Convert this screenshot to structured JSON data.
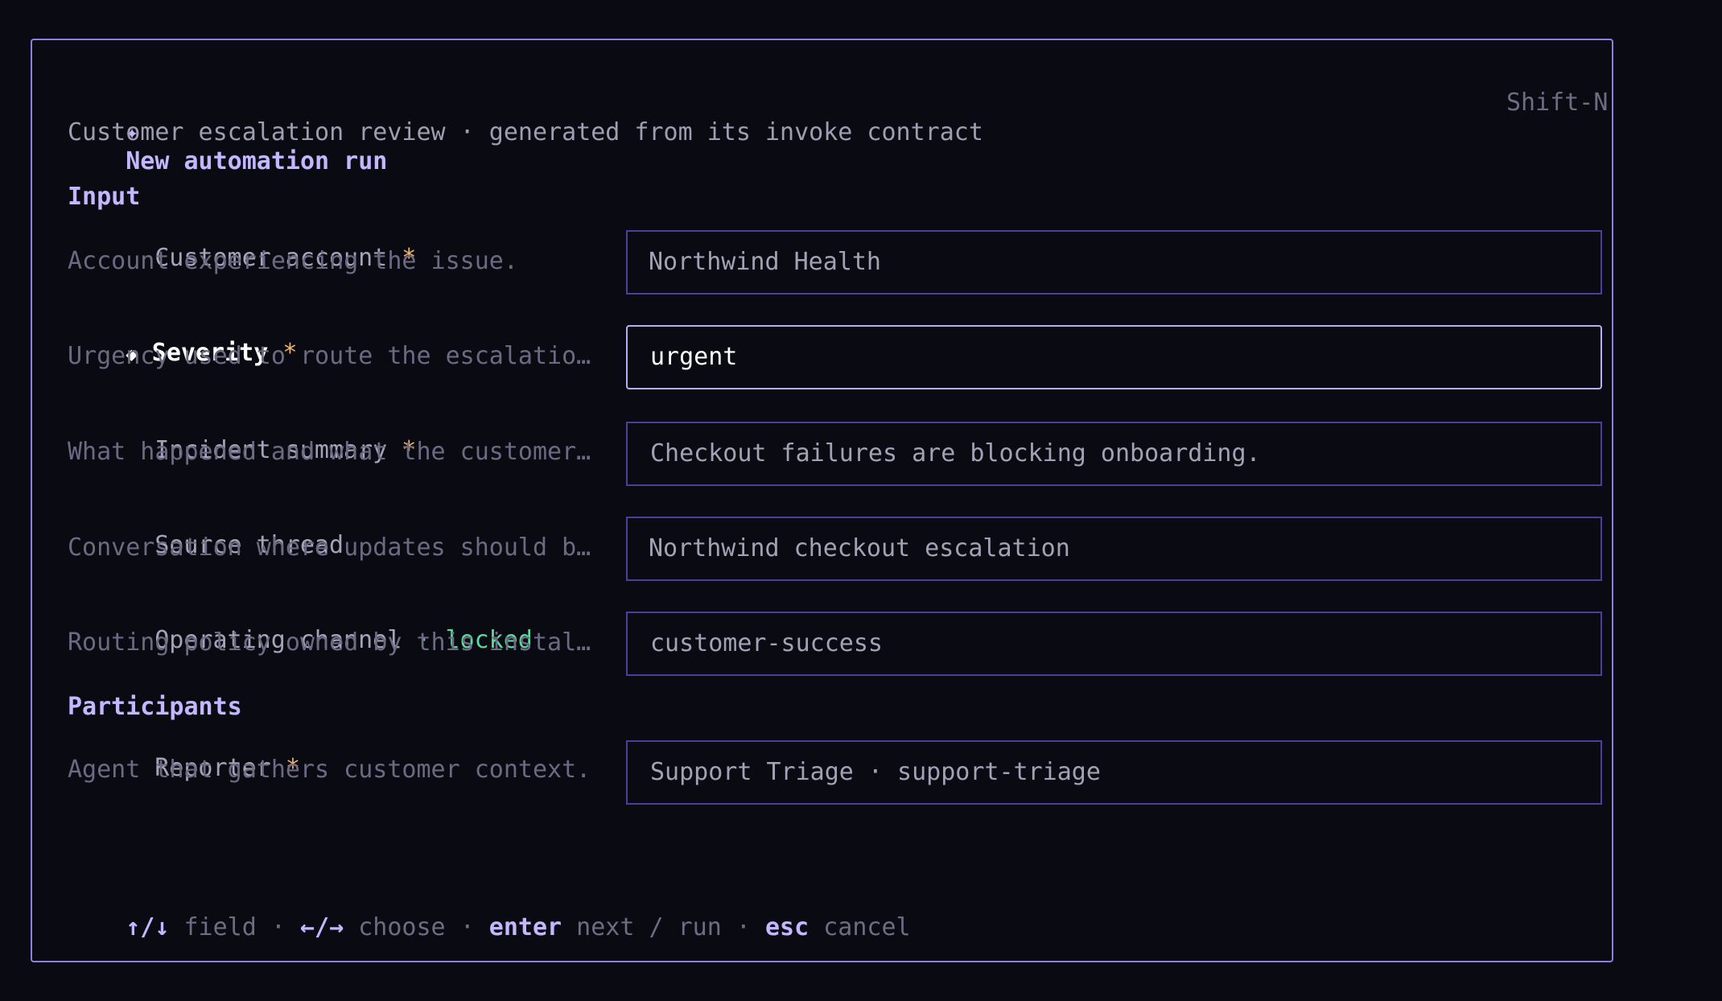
{
  "header": {
    "icon": "sparkle-icon",
    "icon_glyph": "✦",
    "title": "New automation run",
    "subtitle": "Customer escalation review · generated from its invoke contract",
    "shortcut": "Shift-N"
  },
  "sections": {
    "input": "Input",
    "participants": "Participants"
  },
  "fields": [
    {
      "label": "Customer account",
      "required": "*",
      "description": "Account experiencing the issue.",
      "value": "Northwind Health"
    },
    {
      "marker": "◆",
      "label": "Severity",
      "required": "*",
      "description": "Urgency used to route the escalatio…",
      "value": "urgent"
    },
    {
      "label": "Incident summary",
      "required": "*",
      "description": "What happened and what the customer…",
      "value": "Checkout failures are blocking onboarding."
    },
    {
      "label": "Source thread",
      "description": "Conversation where updates should b…",
      "value": "Northwind checkout escalation"
    },
    {
      "label": "Operating channel",
      "locked_sep": " · ",
      "locked": "locked",
      "description": "Routing policy owned by this instal…",
      "value": "customer-success"
    },
    {
      "label": "Reporter",
      "required": "*",
      "description": "Agent that gathers customer context.",
      "value": "Support Triage · support-triage"
    }
  ],
  "footer": {
    "k1": "↑/↓",
    "a1": " field ",
    "s1": "·",
    "k2": " ←/→",
    "a2": " choose ",
    "s2": "·",
    "k3": " enter",
    "a3": " next / run ",
    "s3": "·",
    "k4": " esc",
    "a4": " cancel"
  },
  "colors": {
    "background": "#0a0a12",
    "accent": "#c4b6ff",
    "border": "#8c7fe0",
    "required": "#f2b56b",
    "locked": "#5fd79d"
  }
}
